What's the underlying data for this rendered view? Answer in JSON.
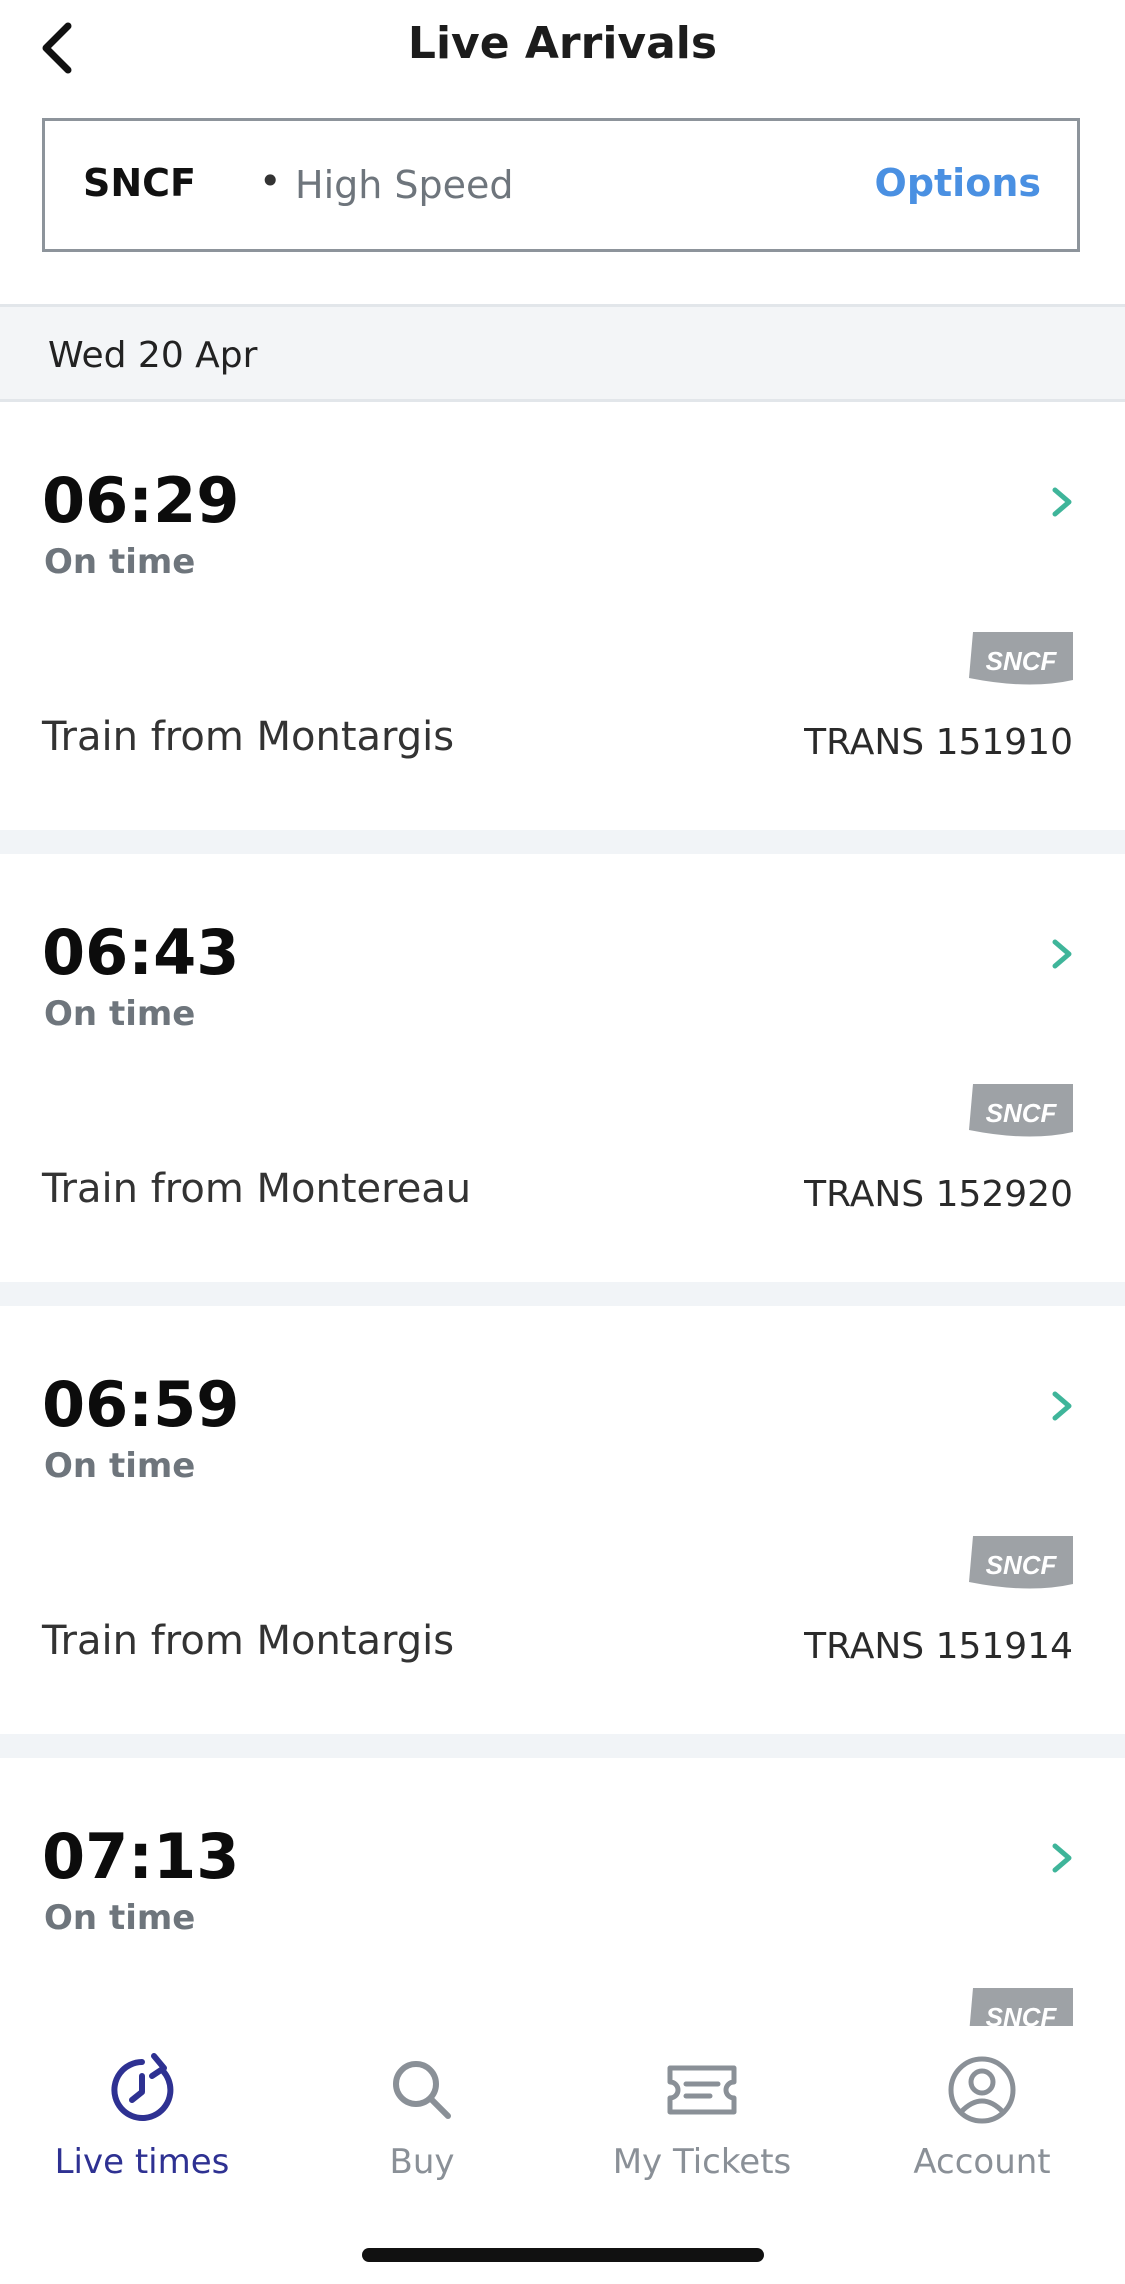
{
  "header": {
    "title": "Live Arrivals",
    "back_icon": "chevron-left-icon"
  },
  "filter": {
    "operator": "SNCF",
    "separator": "•",
    "mode": "High Speed",
    "options_label": "Options"
  },
  "date_label": "Wed 20 Apr",
  "arrivals": [
    {
      "time": "06:29",
      "status": "On time",
      "origin": "Train from Montargis",
      "train_number": "TRANS 151910",
      "logo_text": "SNCF"
    },
    {
      "time": "06:43",
      "status": "On time",
      "origin": "Train from Montereau",
      "train_number": "TRANS 152920",
      "logo_text": "SNCF"
    },
    {
      "time": "06:59",
      "status": "On time",
      "origin": "Train from Montargis",
      "train_number": "TRANS 151914",
      "logo_text": "SNCF"
    },
    {
      "time": "07:13",
      "status": "On time",
      "origin": "",
      "train_number": "",
      "logo_text": "SNCF"
    }
  ],
  "tabs": [
    {
      "label": "Live times",
      "icon": "clock-refresh-icon",
      "active": true
    },
    {
      "label": "Buy",
      "icon": "search-icon",
      "active": false
    },
    {
      "label": "My Tickets",
      "icon": "ticket-icon",
      "active": false
    },
    {
      "label": "Account",
      "icon": "account-icon",
      "active": false
    }
  ],
  "colors": {
    "accent": "#4a90e2",
    "active_tab": "#2e3192",
    "chevron": "#3fb59a",
    "logo": "#9ea2a6"
  }
}
